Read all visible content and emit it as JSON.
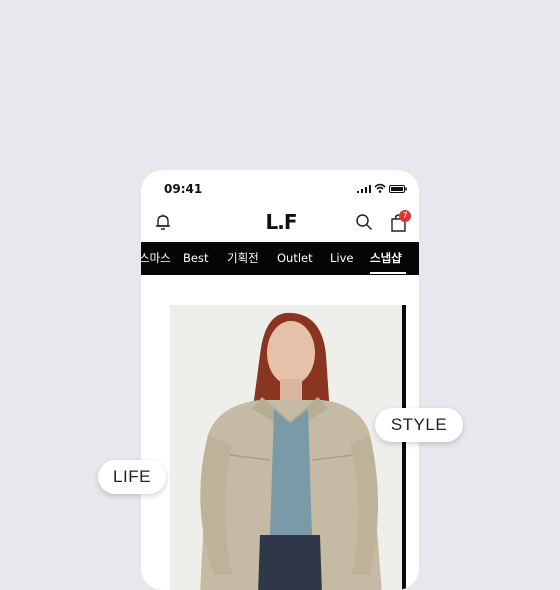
{
  "status_bar": {
    "time": "09:41"
  },
  "header": {
    "logo": "L.F",
    "cart_count": "7"
  },
  "nav": {
    "items": [
      {
        "label": "스마스",
        "active": false
      },
      {
        "label": "Best",
        "active": false
      },
      {
        "label": "기획전",
        "active": false
      },
      {
        "label": "Outlet",
        "active": false
      },
      {
        "label": "Live",
        "active": false
      },
      {
        "label": "스냅샵",
        "active": true
      }
    ]
  },
  "bubbles": {
    "style": "STYLE",
    "life": "LIFE"
  },
  "colors": {
    "nav_bg": "#050505",
    "badge": "#e0322f",
    "page_bg": "#e6e8ee"
  }
}
